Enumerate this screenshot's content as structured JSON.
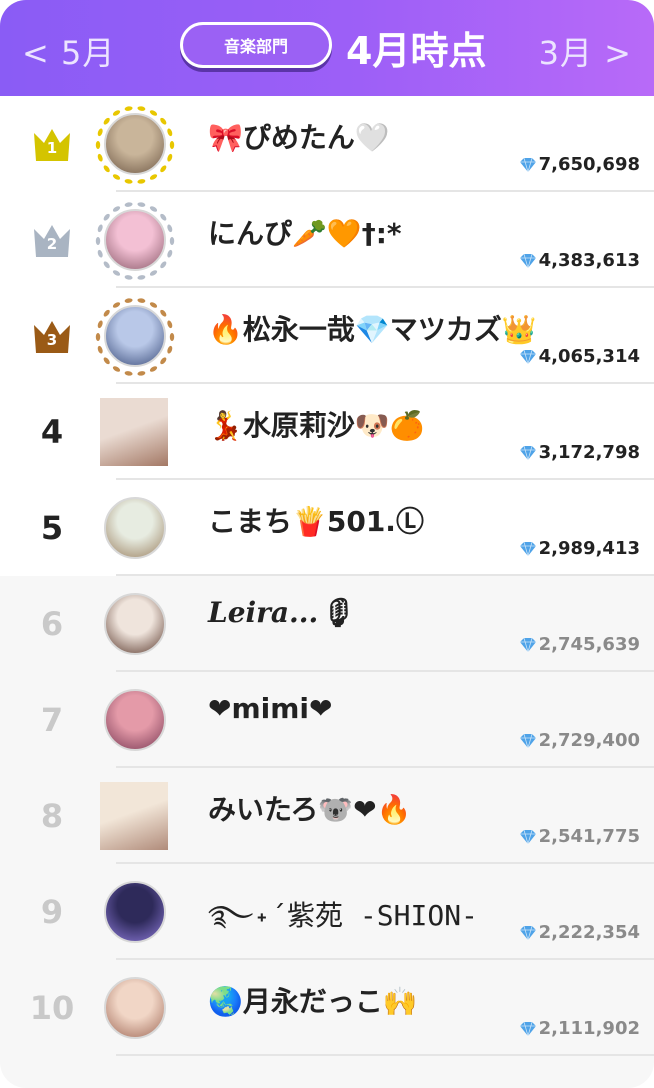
{
  "header": {
    "prev_label": "< 5月",
    "next_label": "3月 >",
    "department": "音楽部門",
    "period": "4月時点"
  },
  "rankings": [
    {
      "rank": "1",
      "name": "🎀ぴめたん🤍",
      "points": "7,650,698",
      "crown_color": "#d4c400",
      "avatar_colors": [
        "#c9b59a",
        "#6e5845"
      ]
    },
    {
      "rank": "2",
      "name": "にんぴ🥕🧡†:*",
      "points": "4,383,613",
      "crown_color": "#a9b4c2",
      "avatar_colors": [
        "#f3c0d4",
        "#8a5a6a"
      ]
    },
    {
      "rank": "3",
      "name": "🔥松永一哉💎マツカズ👑",
      "points": "4,065,314",
      "crown_color": "#9a5a16",
      "avatar_colors": [
        "#b9c8e8",
        "#3a4c7a"
      ]
    },
    {
      "rank": "4",
      "name": "💃水原莉沙🐶🍊",
      "points": "3,172,798",
      "avatar_colors": [
        "#eadbd2",
        "#a37865"
      ]
    },
    {
      "rank": "5",
      "name": "こまち🍟501.Ⓛ",
      "points": "2,989,413",
      "avatar_colors": [
        "#e7ece1",
        "#9a8060"
      ]
    },
    {
      "rank": "6",
      "name": "Leira...🎙",
      "points": "2,745,639",
      "avatar_colors": [
        "#efe4dc",
        "#5b3a2e"
      ]
    },
    {
      "rank": "7",
      "name": "❤mimi❤",
      "points": "2,729,400",
      "avatar_colors": [
        "#e49aa8",
        "#7a3a55"
      ]
    },
    {
      "rank": "8",
      "name": "みいたろ🐨❤🔥",
      "points": "2,541,775",
      "avatar_colors": [
        "#f2e6d8",
        "#b08b7a"
      ]
    },
    {
      "rank": "9",
      "name": "࿐˖´紫苑  -SHION-",
      "points": "2,222,354",
      "avatar_colors": [
        "#2e2a5a",
        "#8d7ad8"
      ]
    },
    {
      "rank": "10",
      "name": "🌏月永だっこ🙌",
      "points": "2,111,902",
      "avatar_colors": [
        "#f1d6c6",
        "#a06a58"
      ]
    }
  ],
  "colors": {
    "header_start": "#8a5cf5",
    "header_end": "#b86af8",
    "gem": "#4fa3e8"
  }
}
